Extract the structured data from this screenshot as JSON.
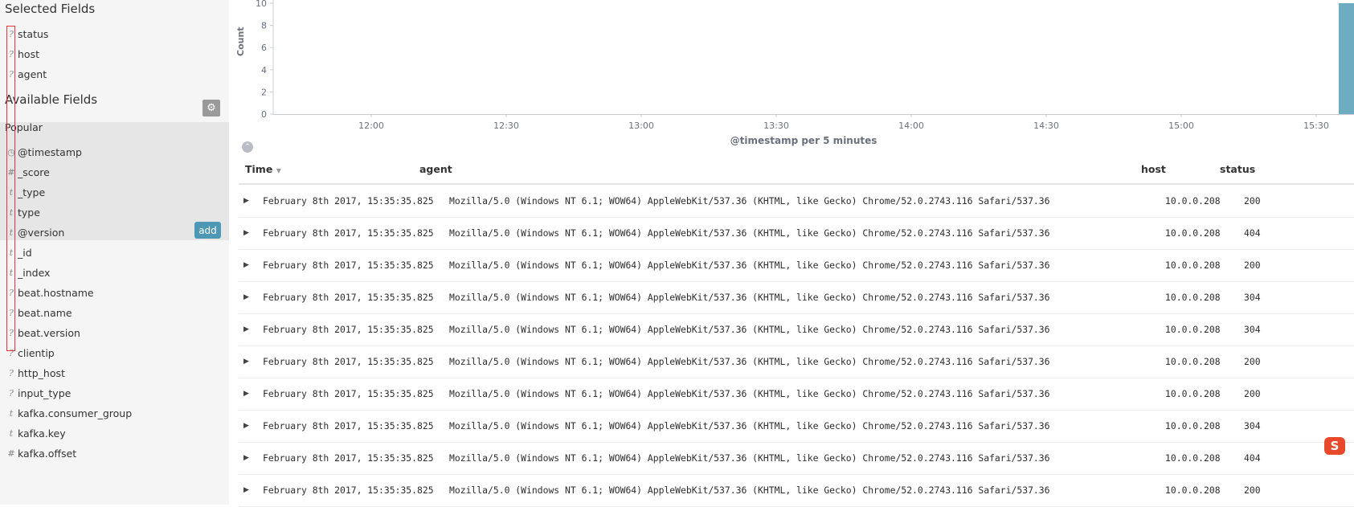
{
  "sidebar": {
    "selected_heading": "Selected Fields",
    "available_heading": "Available Fields",
    "popular_heading": "Popular",
    "add_label": "add",
    "selected_fields": [
      {
        "type": "?",
        "name": "status"
      },
      {
        "type": "?",
        "name": "host"
      },
      {
        "type": "?",
        "name": "agent"
      }
    ],
    "popular_fields": [
      {
        "type": "clock",
        "name": "@timestamp"
      },
      {
        "type": "#",
        "name": "_score"
      },
      {
        "type": "t",
        "name": "_type"
      },
      {
        "type": "t",
        "name": "type"
      }
    ],
    "other_fields": [
      {
        "type": "t",
        "name": "@version"
      },
      {
        "type": "t",
        "name": "_id"
      },
      {
        "type": "t",
        "name": "_index"
      },
      {
        "type": "?",
        "name": "beat.hostname"
      },
      {
        "type": "?",
        "name": "beat.name"
      },
      {
        "type": "?",
        "name": "beat.version"
      },
      {
        "type": "?",
        "name": "clientip"
      },
      {
        "type": "?",
        "name": "http_host"
      },
      {
        "type": "?",
        "name": "input_type"
      },
      {
        "type": "t",
        "name": "kafka.consumer_group"
      },
      {
        "type": "t",
        "name": "kafka.key"
      },
      {
        "type": "#",
        "name": "kafka.offset"
      }
    ]
  },
  "chart_data": {
    "type": "bar",
    "ylabel": "Count",
    "xlabel": "@timestamp per 5 minutes",
    "y_ticks": [
      0,
      2,
      4,
      6,
      8,
      10
    ],
    "x_ticks": [
      "12:00",
      "12:30",
      "13:00",
      "13:30",
      "14:00",
      "14:30",
      "15:00",
      "15:30"
    ],
    "bars": [
      {
        "x": "15:35",
        "value": 10
      }
    ],
    "bar_color": "#6eadc1"
  },
  "table": {
    "headers": {
      "time": "Time",
      "agent": "agent",
      "host": "host",
      "status": "status"
    },
    "rows": [
      {
        "time": "February 8th 2017, 15:35:35.825",
        "agent": "Mozilla/5.0 (Windows NT 6.1; WOW64) AppleWebKit/537.36 (KHTML, like Gecko) Chrome/52.0.2743.116 Safari/537.36",
        "host": "10.0.0.208",
        "status": "200"
      },
      {
        "time": "February 8th 2017, 15:35:35.825",
        "agent": "Mozilla/5.0 (Windows NT 6.1; WOW64) AppleWebKit/537.36 (KHTML, like Gecko) Chrome/52.0.2743.116 Safari/537.36",
        "host": "10.0.0.208",
        "status": "404"
      },
      {
        "time": "February 8th 2017, 15:35:35.825",
        "agent": "Mozilla/5.0 (Windows NT 6.1; WOW64) AppleWebKit/537.36 (KHTML, like Gecko) Chrome/52.0.2743.116 Safari/537.36",
        "host": "10.0.0.208",
        "status": "200"
      },
      {
        "time": "February 8th 2017, 15:35:35.825",
        "agent": "Mozilla/5.0 (Windows NT 6.1; WOW64) AppleWebKit/537.36 (KHTML, like Gecko) Chrome/52.0.2743.116 Safari/537.36",
        "host": "10.0.0.208",
        "status": "304"
      },
      {
        "time": "February 8th 2017, 15:35:35.825",
        "agent": "Mozilla/5.0 (Windows NT 6.1; WOW64) AppleWebKit/537.36 (KHTML, like Gecko) Chrome/52.0.2743.116 Safari/537.36",
        "host": "10.0.0.208",
        "status": "304"
      },
      {
        "time": "February 8th 2017, 15:35:35.825",
        "agent": "Mozilla/5.0 (Windows NT 6.1; WOW64) AppleWebKit/537.36 (KHTML, like Gecko) Chrome/52.0.2743.116 Safari/537.36",
        "host": "10.0.0.208",
        "status": "200"
      },
      {
        "time": "February 8th 2017, 15:35:35.825",
        "agent": "Mozilla/5.0 (Windows NT 6.1; WOW64) AppleWebKit/537.36 (KHTML, like Gecko) Chrome/52.0.2743.116 Safari/537.36",
        "host": "10.0.0.208",
        "status": "200"
      },
      {
        "time": "February 8th 2017, 15:35:35.825",
        "agent": "Mozilla/5.0 (Windows NT 6.1; WOW64) AppleWebKit/537.36 (KHTML, like Gecko) Chrome/52.0.2743.116 Safari/537.36",
        "host": "10.0.0.208",
        "status": "304"
      },
      {
        "time": "February 8th 2017, 15:35:35.825",
        "agent": "Mozilla/5.0 (Windows NT 6.1; WOW64) AppleWebKit/537.36 (KHTML, like Gecko) Chrome/52.0.2743.116 Safari/537.36",
        "host": "10.0.0.208",
        "status": "404"
      },
      {
        "time": "February 8th 2017, 15:35:35.825",
        "agent": "Mozilla/5.0 (Windows NT 6.1; WOW64) AppleWebKit/537.36 (KHTML, like Gecko) Chrome/52.0.2743.116 Safari/537.36",
        "host": "10.0.0.208",
        "status": "200"
      }
    ]
  },
  "icons": {
    "gear": "gear-icon",
    "collapse": "chevron-up-icon",
    "expand_row": "caret-right-icon",
    "sort": "sort-down-icon",
    "overlay_badge": "sogou-s-icon"
  },
  "overlay_badge_letter": "S"
}
